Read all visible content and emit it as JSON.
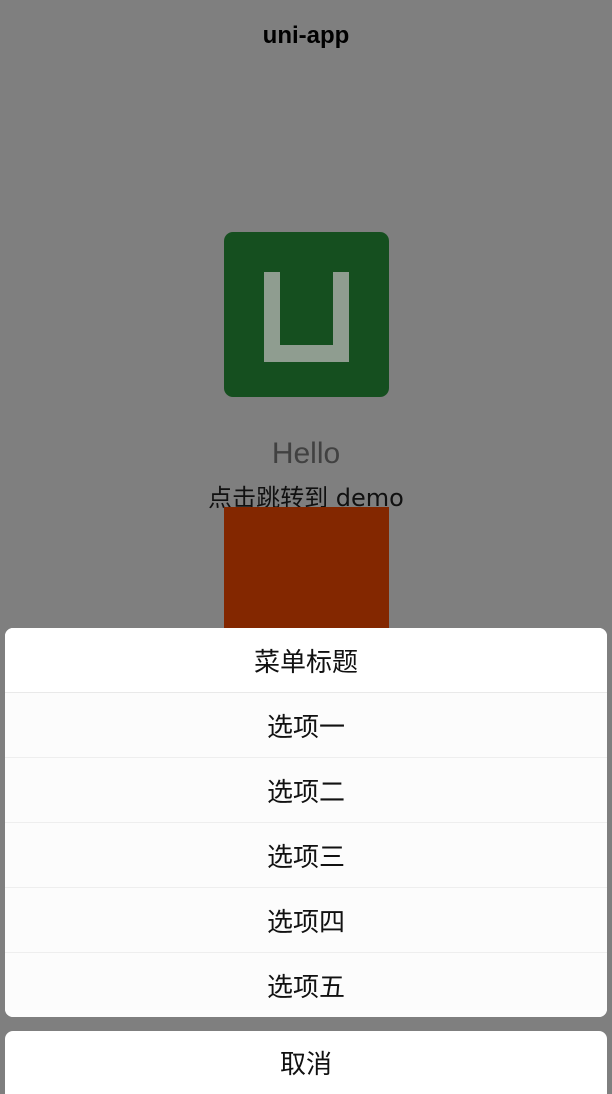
{
  "navbar": {
    "title": "uni-app"
  },
  "content": {
    "logo_icon": "uni-app-logo-icon",
    "hello_text": "Hello",
    "link_text": "点击跳转到 demo"
  },
  "action_sheet": {
    "title": "菜单标题",
    "items": [
      {
        "label": "选项一"
      },
      {
        "label": "选项二"
      },
      {
        "label": "选项三"
      },
      {
        "label": "选项四"
      },
      {
        "label": "选项五"
      }
    ],
    "cancel_label": "取消"
  },
  "colors": {
    "overlay": "#7f7f7f",
    "logo_background": "#154f1f",
    "red_block": "#832700"
  }
}
